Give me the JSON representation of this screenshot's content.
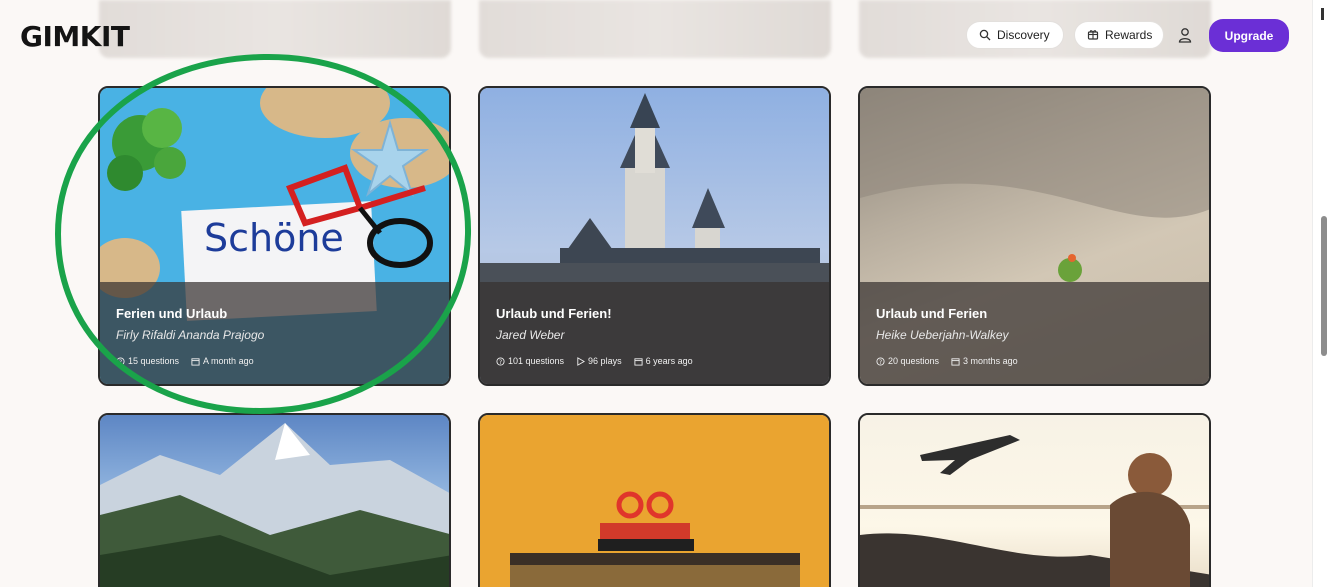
{
  "header": {
    "logo": "GIMKIT",
    "discovery_label": "Discovery",
    "rewards_label": "Rewards",
    "upgrade_label": "Upgrade"
  },
  "cards": [
    {
      "title": "Ferien und Urlaub",
      "author": "Firly Rifaldi Ananda Prajogo",
      "questions": "15 questions",
      "age": "A month ago",
      "image_text": "Schöne"
    },
    {
      "title": "Urlaub und Ferien!",
      "author": "Jared Weber",
      "questions": "101 questions",
      "plays": "96 plays",
      "age": "6 years ago"
    },
    {
      "title": "Urlaub und Ferien",
      "author": "Heike Ueberjahn-Walkey",
      "questions": "20 questions",
      "age": "3 months ago"
    },
    {
      "image": "matterhorn-mountain"
    },
    {
      "image": "red-sunglasses-books-suitcase"
    },
    {
      "image": "traveler-airport-window-airplane"
    }
  ],
  "colors": {
    "accent": "#6b2fd6",
    "highlight_circle": "#1aa34a",
    "card_overlay": "#373230"
  }
}
